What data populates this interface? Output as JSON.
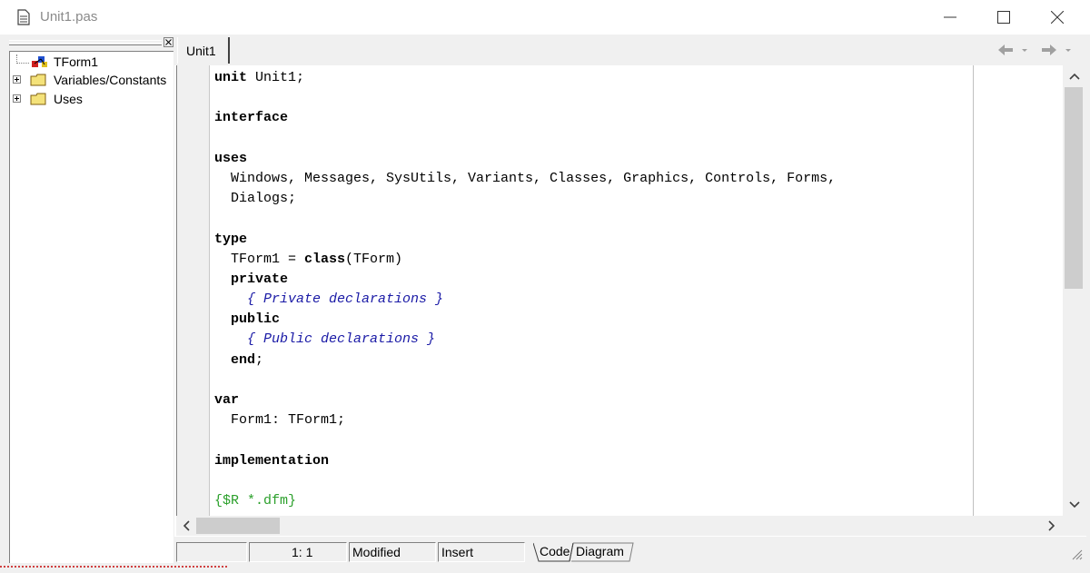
{
  "window": {
    "title": "Unit1.pas",
    "title_color": "#8a8a8a"
  },
  "explorer": {
    "items": [
      {
        "label": "TForm1",
        "icon": "class-icon",
        "expandable": false
      },
      {
        "label": "Variables/Constants",
        "icon": "folder-icon",
        "expandable": true
      },
      {
        "label": "Uses",
        "icon": "folder-icon",
        "expandable": true
      }
    ]
  },
  "editor": {
    "tab_label": "Unit1",
    "code_lines": [
      {
        "parts": [
          {
            "t": "unit",
            "k": "kw"
          },
          {
            "t": " Unit1;",
            "k": ""
          }
        ]
      },
      {
        "parts": []
      },
      {
        "parts": [
          {
            "t": "interface",
            "k": "kw"
          }
        ]
      },
      {
        "parts": []
      },
      {
        "parts": [
          {
            "t": "uses",
            "k": "kw"
          }
        ]
      },
      {
        "parts": [
          {
            "t": "  Windows, Messages, SysUtils, Variants, Classes, Graphics, Controls, Forms,",
            "k": ""
          }
        ]
      },
      {
        "parts": [
          {
            "t": "  Dialogs;",
            "k": ""
          }
        ]
      },
      {
        "parts": []
      },
      {
        "parts": [
          {
            "t": "type",
            "k": "kw"
          }
        ]
      },
      {
        "parts": [
          {
            "t": "  TForm1 = ",
            "k": ""
          },
          {
            "t": "class",
            "k": "kw"
          },
          {
            "t": "(TForm)",
            "k": ""
          }
        ]
      },
      {
        "parts": [
          {
            "t": "  ",
            "k": ""
          },
          {
            "t": "private",
            "k": "kw"
          }
        ]
      },
      {
        "parts": [
          {
            "t": "    { Private declarations }",
            "k": "cmt"
          }
        ]
      },
      {
        "parts": [
          {
            "t": "  ",
            "k": ""
          },
          {
            "t": "public",
            "k": "kw"
          }
        ]
      },
      {
        "parts": [
          {
            "t": "    { Public declarations }",
            "k": "cmt"
          }
        ]
      },
      {
        "parts": [
          {
            "t": "  ",
            "k": ""
          },
          {
            "t": "end",
            "k": "kw"
          },
          {
            "t": ";",
            "k": ""
          }
        ]
      },
      {
        "parts": []
      },
      {
        "parts": [
          {
            "t": "var",
            "k": "kw"
          }
        ]
      },
      {
        "parts": [
          {
            "t": "  Form1: TForm1;",
            "k": ""
          }
        ]
      },
      {
        "parts": []
      },
      {
        "parts": [
          {
            "t": "implementation",
            "k": "kw"
          }
        ]
      },
      {
        "parts": []
      },
      {
        "parts": [
          {
            "t": "{$R *.dfm}",
            "k": "dir"
          }
        ]
      }
    ],
    "comment_color": "#1a1aa6",
    "directive_color": "#2ca02c"
  },
  "statusbar": {
    "position": "1:  1",
    "modified": "Modified",
    "mode": "Insert",
    "view_tabs": [
      "Code",
      "Diagram"
    ]
  }
}
